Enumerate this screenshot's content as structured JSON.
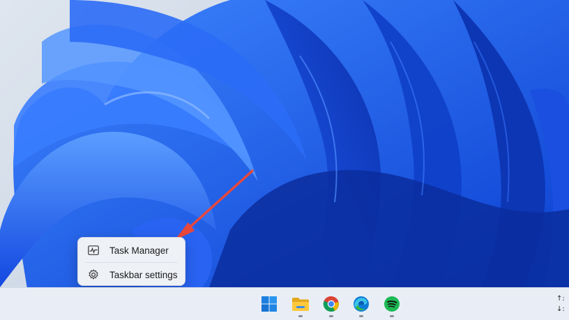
{
  "context_menu": {
    "items": [
      {
        "label": "Task Manager",
        "icon": "task-manager-icon"
      },
      {
        "label": "Taskbar settings",
        "icon": "gear-icon"
      }
    ]
  },
  "annotation": {
    "type": "arrow",
    "color": "#e8473c"
  },
  "taskbar": {
    "apps": [
      {
        "name": "start",
        "icon": "windows-start-icon"
      },
      {
        "name": "file-explorer",
        "icon": "folder-icon"
      },
      {
        "name": "chrome",
        "icon": "chrome-icon"
      },
      {
        "name": "edge",
        "icon": "edge-icon"
      },
      {
        "name": "spotify",
        "icon": "spotify-icon"
      }
    ],
    "tray": {
      "line1": "↑:",
      "line2": "↓:"
    }
  },
  "colors": {
    "wallpaper_blue": "#1d5bf0",
    "wallpaper_light": "#dfe6ef",
    "taskbar": "#e9eef6"
  }
}
